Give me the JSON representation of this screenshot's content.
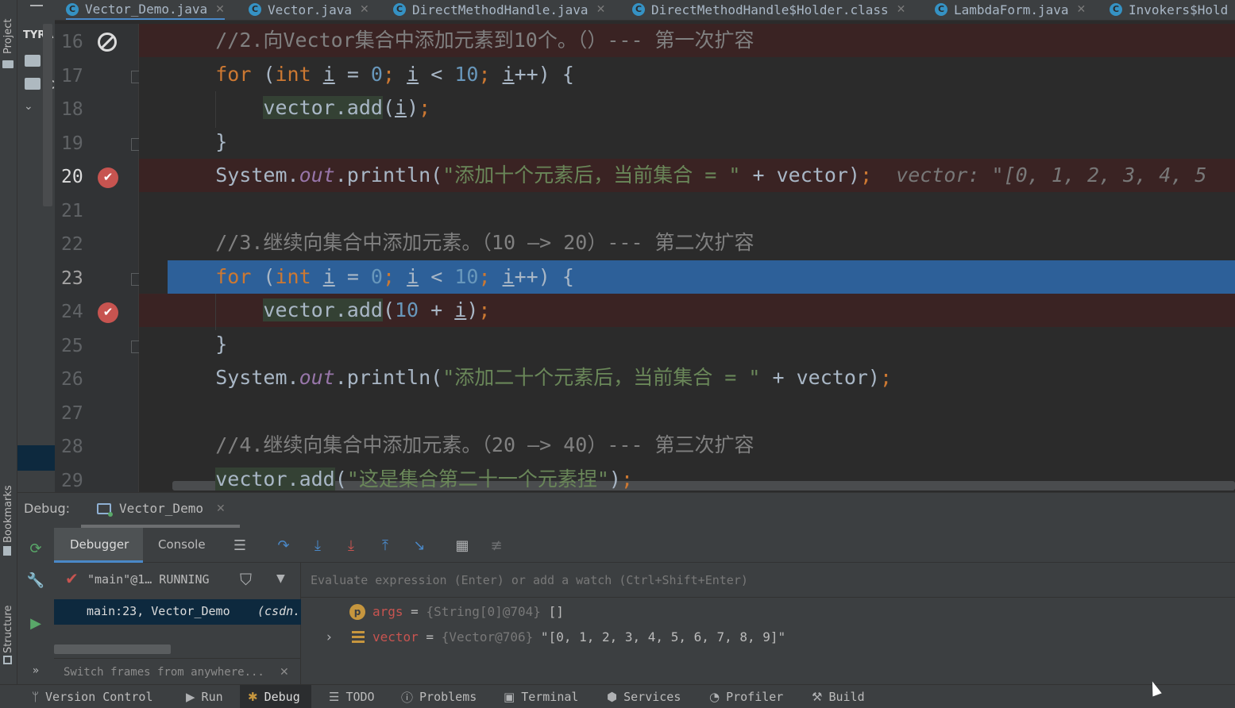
{
  "sidebar_tabs": {
    "project": "Project",
    "bookmarks": "Bookmarks",
    "structure": "Structure"
  },
  "project_panel": {
    "label": "TYRA",
    "item_c": "C"
  },
  "editor_tabs": [
    {
      "label": "Vector_Demo.java",
      "active": true
    },
    {
      "label": "Vector.java",
      "active": false
    },
    {
      "label": "DirectMethodHandle.java",
      "active": false
    },
    {
      "label": "DirectMethodHandle$Holder.class",
      "active": false
    },
    {
      "label": "LambdaForm.java",
      "active": false
    },
    {
      "label": "Invokers$Hold",
      "active": false
    }
  ],
  "line_numbers": [
    "16",
    "17",
    "18",
    "19",
    "20",
    "21",
    "22",
    "23",
    "24",
    "25",
    "26",
    "27",
    "28",
    "29"
  ],
  "code": [
    {
      "line": "16",
      "state": "bp",
      "tokens": [
        [
          "    ",
          "#a9b7c6"
        ],
        [
          "//2.向Vector集合中添加元素到10个。（）--- 第一次扩容",
          "#808080"
        ]
      ]
    },
    {
      "line": "17",
      "state": "",
      "tokens": [
        [
          "    ",
          "#a9b7c6"
        ],
        [
          "for",
          "#cc7832"
        ],
        [
          " (",
          "#a9b7c6"
        ],
        [
          "int",
          "#cc7832"
        ],
        [
          " ",
          "#a9b7c6"
        ],
        [
          "i",
          "#a9b7c6",
          "u"
        ],
        [
          " = ",
          "#a9b7c6"
        ],
        [
          "0",
          "#6897bb"
        ],
        [
          ";",
          "#cc7832"
        ],
        [
          " ",
          "#a9b7c6"
        ],
        [
          "i",
          "#a9b7c6",
          "u"
        ],
        [
          " < ",
          "#a9b7c6"
        ],
        [
          "10",
          "#6897bb"
        ],
        [
          ";",
          "#cc7832"
        ],
        [
          " ",
          "#a9b7c6"
        ],
        [
          "i",
          "#a9b7c6",
          "u"
        ],
        [
          "++) {",
          "#a9b7c6"
        ]
      ]
    },
    {
      "line": "18",
      "state": "",
      "tokens": [
        [
          "        ",
          "#a9b7c6"
        ],
        [
          "vector.add",
          "#a9b7c6",
          "h"
        ],
        [
          "(",
          "#a9b7c6"
        ],
        [
          "i",
          "#a9b7c6",
          "u"
        ],
        [
          ")",
          "#a9b7c6"
        ],
        [
          ";",
          "#cc7832"
        ]
      ]
    },
    {
      "line": "19",
      "state": "",
      "tokens": [
        [
          "    }",
          "#a9b7c6"
        ]
      ]
    },
    {
      "line": "20",
      "state": "bp",
      "tokens": [
        [
          "    System.",
          "#a9b7c6"
        ],
        [
          "out",
          "#9876aa",
          "i"
        ],
        [
          ".println(",
          "#a9b7c6"
        ],
        [
          "\"添加十个元素后，当前集合 = \"",
          "#6a8759"
        ],
        [
          " + vector)",
          "#a9b7c6"
        ],
        [
          ";",
          "#cc7832"
        ],
        [
          "  vector: \"[0, 1, 2, 3, 4, 5",
          "#787878",
          "i"
        ]
      ]
    },
    {
      "line": "21",
      "state": "",
      "tokens": [
        [
          "",
          "#a9b7c6"
        ]
      ]
    },
    {
      "line": "22",
      "state": "",
      "tokens": [
        [
          "    ",
          "#a9b7c6"
        ],
        [
          "//3.继续向集合中添加元素。（10 —> 20）--- 第二次扩容",
          "#808080"
        ]
      ]
    },
    {
      "line": "23",
      "state": "cur",
      "tokens": [
        [
          "    ",
          "#a9b7c6"
        ],
        [
          "for",
          "#cc7832"
        ],
        [
          " (",
          "#a9b7c6"
        ],
        [
          "int",
          "#cc7832"
        ],
        [
          " ",
          "#a9b7c6"
        ],
        [
          "i",
          "#a9b7c6",
          "u"
        ],
        [
          " = ",
          "#a9b7c6"
        ],
        [
          "0",
          "#6897bb"
        ],
        [
          ";",
          "#cc7832"
        ],
        [
          " ",
          "#a9b7c6"
        ],
        [
          "i",
          "#a9b7c6",
          "u"
        ],
        [
          " < ",
          "#a9b7c6"
        ],
        [
          "10",
          "#6897bb"
        ],
        [
          ";",
          "#cc7832"
        ],
        [
          " ",
          "#a9b7c6"
        ],
        [
          "i",
          "#a9b7c6",
          "u"
        ],
        [
          "++) {",
          "#a9b7c6"
        ]
      ]
    },
    {
      "line": "24",
      "state": "bp",
      "tokens": [
        [
          "        ",
          "#a9b7c6"
        ],
        [
          "vector.add",
          "#a9b7c6",
          "h"
        ],
        [
          "(",
          "#a9b7c6"
        ],
        [
          "10",
          "#6897bb"
        ],
        [
          " + ",
          "#a9b7c6"
        ],
        [
          "i",
          "#a9b7c6",
          "u"
        ],
        [
          ")",
          "#a9b7c6"
        ],
        [
          ";",
          "#cc7832"
        ]
      ]
    },
    {
      "line": "25",
      "state": "",
      "tokens": [
        [
          "    }",
          "#a9b7c6"
        ]
      ]
    },
    {
      "line": "26",
      "state": "",
      "tokens": [
        [
          "    System.",
          "#a9b7c6"
        ],
        [
          "out",
          "#9876aa",
          "i"
        ],
        [
          ".println(",
          "#a9b7c6"
        ],
        [
          "\"添加二十个元素后，当前集合 = \"",
          "#6a8759"
        ],
        [
          " + vector)",
          "#a9b7c6"
        ],
        [
          ";",
          "#cc7832"
        ]
      ]
    },
    {
      "line": "27",
      "state": "",
      "tokens": [
        [
          "",
          "#a9b7c6"
        ]
      ]
    },
    {
      "line": "28",
      "state": "",
      "tokens": [
        [
          "    ",
          "#a9b7c6"
        ],
        [
          "//4.继续向集合中添加元素。（20 —> 40）--- 第三次扩容",
          "#808080"
        ]
      ]
    },
    {
      "line": "29",
      "state": "",
      "tokens": [
        [
          "    ",
          "#a9b7c6"
        ],
        [
          "vector.add",
          "#a9b7c6",
          "h"
        ],
        [
          "(",
          "#a9b7c6"
        ],
        [
          "\"这是集合第二十一个元素捏\"",
          "#6a8759"
        ],
        [
          ")",
          "#a9b7c6"
        ],
        [
          ";",
          "#cc7832"
        ]
      ]
    }
  ],
  "debug": {
    "title": "Debug:",
    "session": "Vector_Demo",
    "tab_debugger": "Debugger",
    "tab_console": "Console",
    "thread": "\"main\"@1… RUNNING",
    "frame_method": "main:23, Vector_Demo",
    "frame_pkg": "(csdn.",
    "switch_hint": "Switch frames from anywhere...",
    "eval_placeholder": "Evaluate expression (Enter) or add a watch (Ctrl+Shift+Enter)",
    "variables": [
      {
        "name": "args",
        "eq": " = ",
        "type": "{String[0]@704}",
        "value": " []",
        "badge": "p",
        "expandable": false
      },
      {
        "name": "vector",
        "eq": " = ",
        "type": "{Vector@706}",
        "value": " \"[0, 1, 2, 3, 4, 5, 6, 7, 8, 9]\"",
        "badge": "list",
        "expandable": true
      }
    ]
  },
  "statusbar": [
    {
      "label": "Version Control",
      "icon": "branch-icon"
    },
    {
      "label": "Run",
      "icon": "play-icon"
    },
    {
      "label": "Debug",
      "icon": "bug-icon",
      "active": true
    },
    {
      "label": "TODO",
      "icon": "list-icon"
    },
    {
      "label": "Problems",
      "icon": "info-icon"
    },
    {
      "label": "Terminal",
      "icon": "terminal-icon"
    },
    {
      "label": "Services",
      "icon": "services-icon"
    },
    {
      "label": "Profiler",
      "icon": "profiler-icon"
    },
    {
      "label": "Build",
      "icon": "hammer-icon"
    }
  ],
  "colors": {
    "keyword": "#cc7832",
    "number": "#6897bb",
    "string": "#6a8759",
    "comment": "#808080",
    "field": "#9876aa",
    "selection": "#2d6099",
    "breakpoint": "#c75450"
  }
}
